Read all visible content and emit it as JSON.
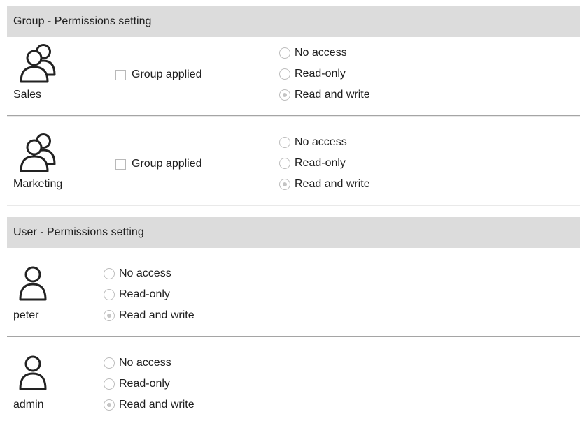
{
  "group_section": {
    "title": "Group - Permissions setting",
    "groups": [
      {
        "name": "Sales",
        "icon": "group-icon",
        "checkbox_label": "Group applied",
        "checkbox_checked": false,
        "options": [
          "No access",
          "Read-only",
          "Read and write"
        ],
        "selected": "Read and write"
      },
      {
        "name": "Marketing",
        "icon": "group-icon",
        "checkbox_label": "Group applied",
        "checkbox_checked": false,
        "options": [
          "No access",
          "Read-only",
          "Read and write"
        ],
        "selected": "Read and write"
      }
    ]
  },
  "user_section": {
    "title": "User - Permissions setting",
    "users": [
      {
        "name": "peter",
        "icon": "user-icon",
        "options": [
          "No access",
          "Read-only",
          "Read and write"
        ],
        "selected": "Read and write"
      },
      {
        "name": "admin",
        "icon": "user-icon",
        "options": [
          "No access",
          "Read-only",
          "Read and write"
        ],
        "selected": "Read and write"
      }
    ]
  },
  "colors": {
    "header_background": "#dcdcdc",
    "divider": "#a5a5a5",
    "text": "#1e1e1e"
  }
}
